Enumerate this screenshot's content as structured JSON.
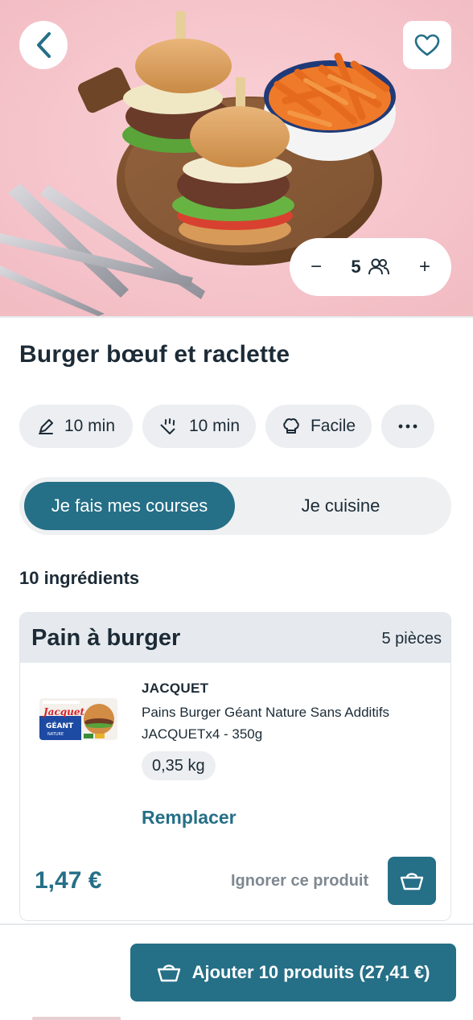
{
  "hero": {
    "image_name": "burger-photo",
    "servings": {
      "count": "5",
      "minus": "−",
      "plus": "+"
    }
  },
  "recipe": {
    "title": "Burger bœuf et raclette",
    "chips": [
      {
        "icon": "pencil-icon",
        "label": "10 min"
      },
      {
        "icon": "cooking-icon",
        "label": "10 min"
      },
      {
        "icon": "chef-hat-icon",
        "label": "Facile"
      },
      {
        "icon": "more-icon",
        "label": "···"
      }
    ]
  },
  "tabs": {
    "active": "Je fais mes courses",
    "inactive": "Je cuisine"
  },
  "ingredients": {
    "count_label": "10 ingrédients",
    "card": {
      "name": "Pain à burger",
      "quantity": "5 pièces",
      "product": {
        "brand": "JACQUET",
        "description": "Pains Burger Géant Nature Sans Additifs JACQUETx4 - 350g",
        "weight": "0,35 kg",
        "package_text_brand": "Jacquet",
        "package_text_product": "GÉANT",
        "package_text_sub": "NATURE"
      },
      "replace_label": "Remplacer",
      "price": "1,47 €",
      "ignore_label": "Ignorer ce produit"
    }
  },
  "cta": {
    "label": "Ajouter 10 produits (27,41 €)"
  },
  "colors": {
    "primary": "#256f87",
    "text": "#1c2b36",
    "chip_bg": "#eceef1",
    "hero_bg": "#f7c9cf"
  }
}
